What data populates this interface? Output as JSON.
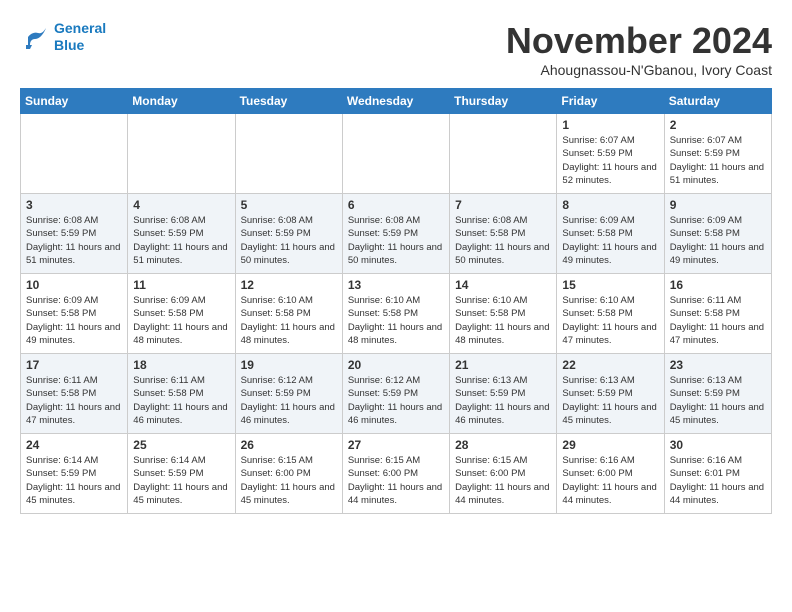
{
  "header": {
    "logo_line1": "General",
    "logo_line2": "Blue",
    "month": "November 2024",
    "location": "Ahougnassou-N'Gbanou, Ivory Coast"
  },
  "weekdays": [
    "Sunday",
    "Monday",
    "Tuesday",
    "Wednesday",
    "Thursday",
    "Friday",
    "Saturday"
  ],
  "weeks": [
    [
      {
        "day": "",
        "info": ""
      },
      {
        "day": "",
        "info": ""
      },
      {
        "day": "",
        "info": ""
      },
      {
        "day": "",
        "info": ""
      },
      {
        "day": "",
        "info": ""
      },
      {
        "day": "1",
        "info": "Sunrise: 6:07 AM\nSunset: 5:59 PM\nDaylight: 11 hours and 52 minutes."
      },
      {
        "day": "2",
        "info": "Sunrise: 6:07 AM\nSunset: 5:59 PM\nDaylight: 11 hours and 51 minutes."
      }
    ],
    [
      {
        "day": "3",
        "info": "Sunrise: 6:08 AM\nSunset: 5:59 PM\nDaylight: 11 hours and 51 minutes."
      },
      {
        "day": "4",
        "info": "Sunrise: 6:08 AM\nSunset: 5:59 PM\nDaylight: 11 hours and 51 minutes."
      },
      {
        "day": "5",
        "info": "Sunrise: 6:08 AM\nSunset: 5:59 PM\nDaylight: 11 hours and 50 minutes."
      },
      {
        "day": "6",
        "info": "Sunrise: 6:08 AM\nSunset: 5:59 PM\nDaylight: 11 hours and 50 minutes."
      },
      {
        "day": "7",
        "info": "Sunrise: 6:08 AM\nSunset: 5:58 PM\nDaylight: 11 hours and 50 minutes."
      },
      {
        "day": "8",
        "info": "Sunrise: 6:09 AM\nSunset: 5:58 PM\nDaylight: 11 hours and 49 minutes."
      },
      {
        "day": "9",
        "info": "Sunrise: 6:09 AM\nSunset: 5:58 PM\nDaylight: 11 hours and 49 minutes."
      }
    ],
    [
      {
        "day": "10",
        "info": "Sunrise: 6:09 AM\nSunset: 5:58 PM\nDaylight: 11 hours and 49 minutes."
      },
      {
        "day": "11",
        "info": "Sunrise: 6:09 AM\nSunset: 5:58 PM\nDaylight: 11 hours and 48 minutes."
      },
      {
        "day": "12",
        "info": "Sunrise: 6:10 AM\nSunset: 5:58 PM\nDaylight: 11 hours and 48 minutes."
      },
      {
        "day": "13",
        "info": "Sunrise: 6:10 AM\nSunset: 5:58 PM\nDaylight: 11 hours and 48 minutes."
      },
      {
        "day": "14",
        "info": "Sunrise: 6:10 AM\nSunset: 5:58 PM\nDaylight: 11 hours and 48 minutes."
      },
      {
        "day": "15",
        "info": "Sunrise: 6:10 AM\nSunset: 5:58 PM\nDaylight: 11 hours and 47 minutes."
      },
      {
        "day": "16",
        "info": "Sunrise: 6:11 AM\nSunset: 5:58 PM\nDaylight: 11 hours and 47 minutes."
      }
    ],
    [
      {
        "day": "17",
        "info": "Sunrise: 6:11 AM\nSunset: 5:58 PM\nDaylight: 11 hours and 47 minutes."
      },
      {
        "day": "18",
        "info": "Sunrise: 6:11 AM\nSunset: 5:58 PM\nDaylight: 11 hours and 46 minutes."
      },
      {
        "day": "19",
        "info": "Sunrise: 6:12 AM\nSunset: 5:59 PM\nDaylight: 11 hours and 46 minutes."
      },
      {
        "day": "20",
        "info": "Sunrise: 6:12 AM\nSunset: 5:59 PM\nDaylight: 11 hours and 46 minutes."
      },
      {
        "day": "21",
        "info": "Sunrise: 6:13 AM\nSunset: 5:59 PM\nDaylight: 11 hours and 46 minutes."
      },
      {
        "day": "22",
        "info": "Sunrise: 6:13 AM\nSunset: 5:59 PM\nDaylight: 11 hours and 45 minutes."
      },
      {
        "day": "23",
        "info": "Sunrise: 6:13 AM\nSunset: 5:59 PM\nDaylight: 11 hours and 45 minutes."
      }
    ],
    [
      {
        "day": "24",
        "info": "Sunrise: 6:14 AM\nSunset: 5:59 PM\nDaylight: 11 hours and 45 minutes."
      },
      {
        "day": "25",
        "info": "Sunrise: 6:14 AM\nSunset: 5:59 PM\nDaylight: 11 hours and 45 minutes."
      },
      {
        "day": "26",
        "info": "Sunrise: 6:15 AM\nSunset: 6:00 PM\nDaylight: 11 hours and 45 minutes."
      },
      {
        "day": "27",
        "info": "Sunrise: 6:15 AM\nSunset: 6:00 PM\nDaylight: 11 hours and 44 minutes."
      },
      {
        "day": "28",
        "info": "Sunrise: 6:15 AM\nSunset: 6:00 PM\nDaylight: 11 hours and 44 minutes."
      },
      {
        "day": "29",
        "info": "Sunrise: 6:16 AM\nSunset: 6:00 PM\nDaylight: 11 hours and 44 minutes."
      },
      {
        "day": "30",
        "info": "Sunrise: 6:16 AM\nSunset: 6:01 PM\nDaylight: 11 hours and 44 minutes."
      }
    ]
  ]
}
